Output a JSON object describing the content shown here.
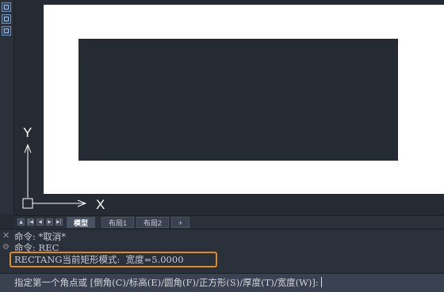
{
  "toolstrip": {
    "icons": [
      "viewcube-icon",
      "grid-icon",
      "layer-icon"
    ]
  },
  "ucs": {
    "x_label": "X",
    "y_label": "Y"
  },
  "tabs": {
    "nav_icons": [
      "first-icon",
      "prev-icon",
      "next-icon",
      "last-icon"
    ],
    "items": [
      {
        "label": "模型",
        "active": true
      },
      {
        "label": "布局1",
        "active": false
      },
      {
        "label": "布局2",
        "active": false
      },
      {
        "label": "+",
        "active": false
      }
    ]
  },
  "command": {
    "history": [
      "命令: *取消*",
      "命令: REC",
      "RECTANG当前矩形模式:  宽度=5.0000"
    ],
    "prompt": "指定第一个角点或 [倒角(C)/标高(E)/圆角(F)/正方形(S)/厚度(T)/宽度(W)]:",
    "highlight_color": "#e08a2c"
  }
}
